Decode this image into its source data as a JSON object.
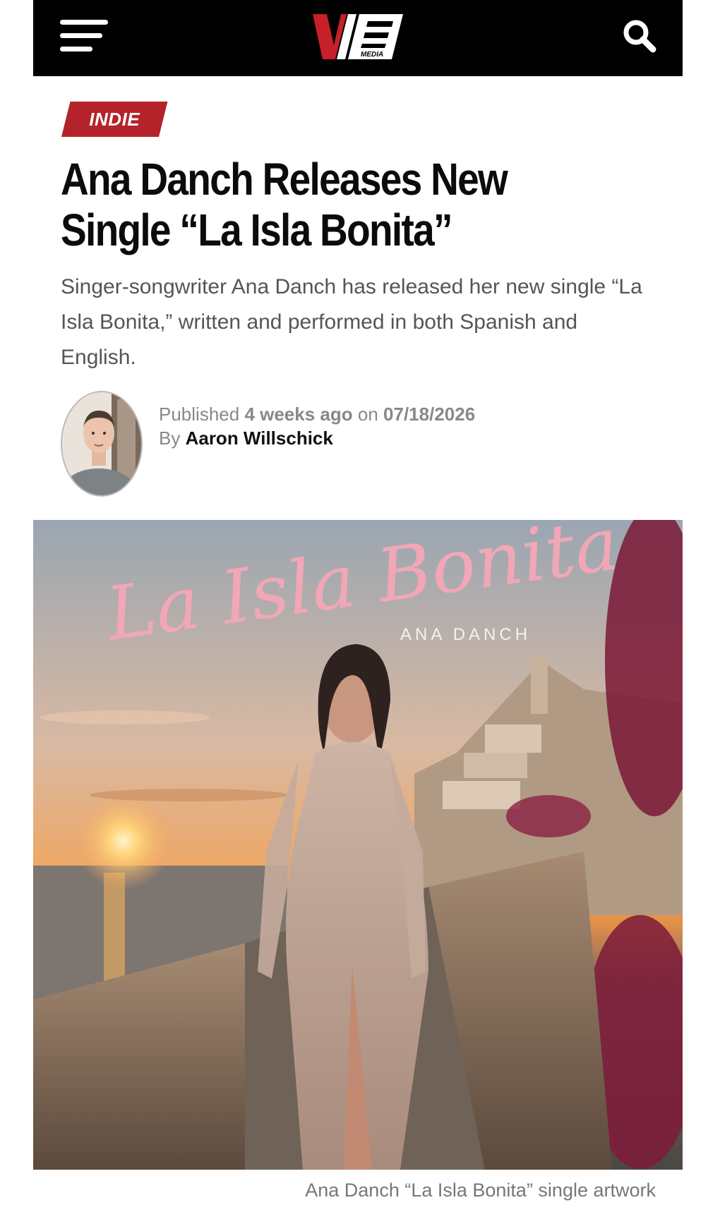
{
  "header": {
    "logo_text": "V",
    "logo_sub": "MEDIA",
    "menu_icon": "hamburger-menu-icon",
    "search_icon": "search-icon"
  },
  "article": {
    "category": "INDIE",
    "title_line1": "Ana Danch Releases New",
    "title_line2": "Single “La Isla Bonita”",
    "excerpt": "Singer-songwriter Ana Danch has released her new single “La Isla Bonita,” written and performed in both Spanish and English.",
    "meta": {
      "published_label": "Published",
      "relative_time": "4 weeks ago",
      "on_label": "on",
      "date": "07/18/2026",
      "by_label": "By",
      "author": "Aaron Willschick"
    },
    "image": {
      "script_title": "La Isla Bonita",
      "artist": "ANA DANCH",
      "caption": "Ana Danch “La Isla Bonita” single artwork"
    }
  },
  "colors": {
    "header_bg": "#000000",
    "category_bg": "#b4232a",
    "accent_red": "#c8202a",
    "headline": "#0b0b0b",
    "body_text": "#555555"
  }
}
